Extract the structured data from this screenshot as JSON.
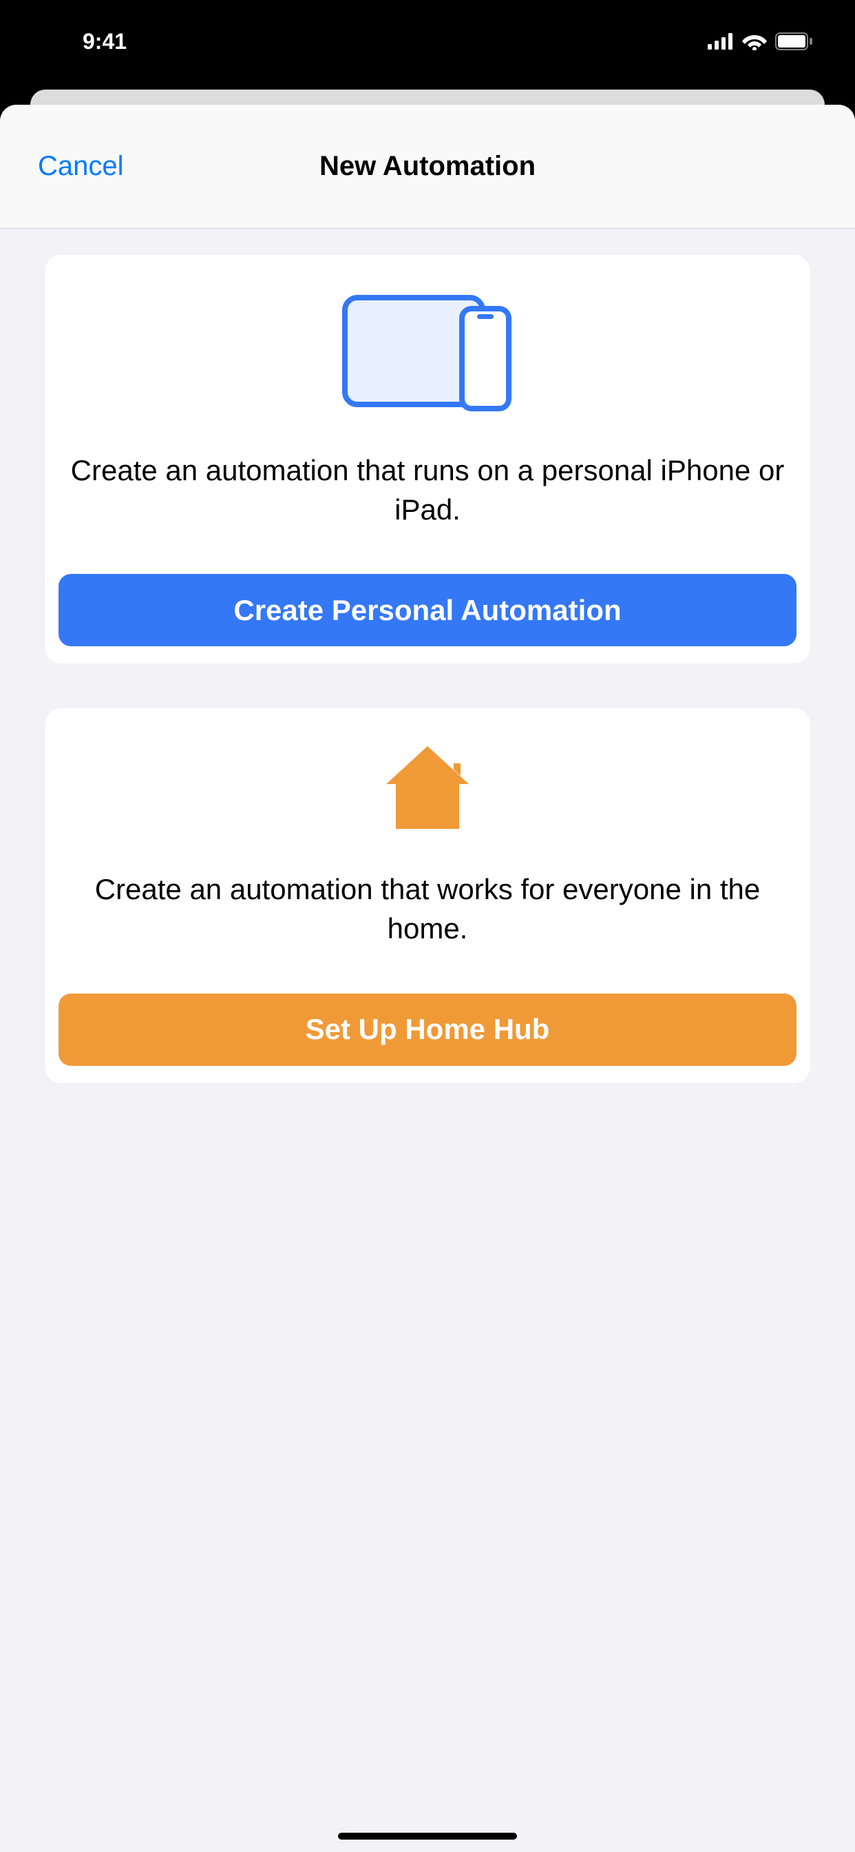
{
  "statusBar": {
    "time": "9:41"
  },
  "navBar": {
    "cancel": "Cancel",
    "title": "New Automation"
  },
  "personalCard": {
    "description": "Create an automation that runs on a personal iPhone or iPad.",
    "buttonLabel": "Create Personal Automation"
  },
  "homeCard": {
    "description": "Create an automation that works for everyone in the home.",
    "buttonLabel": "Set Up Home Hub"
  },
  "colors": {
    "accentBlue": "#007aff",
    "buttonBlue": "#3478f6",
    "buttonOrange": "#f09a37",
    "iconBlue": "#3478f6",
    "iconBlueLight": "#e9f0fd",
    "iconOrange": "#f09a37"
  }
}
